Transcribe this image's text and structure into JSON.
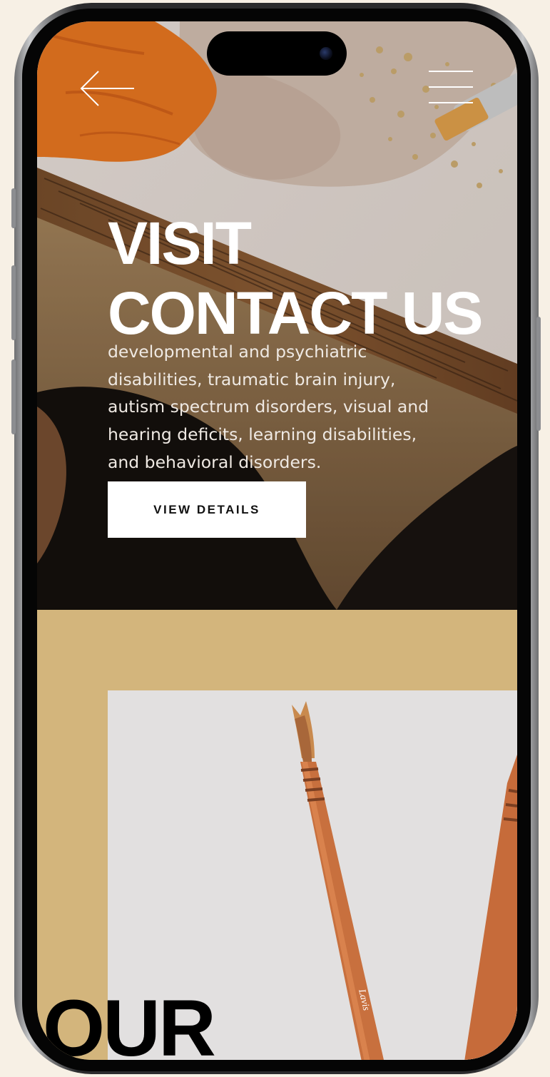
{
  "hero": {
    "title_line1": "VISIT",
    "title_line2": "CONTACT US",
    "description": "developmental and psychiatric disabilities, traumatic brain injury, autism spectrum disorders, visual and hearing deficits, learning disabilities, and behavioral disorders.",
    "cta_label": "VIEW DETAILS",
    "background_image": "artist hands with orange glove, gold leaf and paint brush on table"
  },
  "nav": {
    "back_icon": "arrow-left-icon",
    "menu_icon": "hamburger-menu-icon"
  },
  "section2": {
    "heading": "OUR",
    "image": "two wooden paint brushes on light grey background",
    "brush_text": "Lavis"
  },
  "colors": {
    "page_background": "#f7f0e5",
    "accent_sand": "#d3b57c",
    "button_background": "#ffffff",
    "hero_text": "#ffffff",
    "heading_dark": "#000000"
  }
}
